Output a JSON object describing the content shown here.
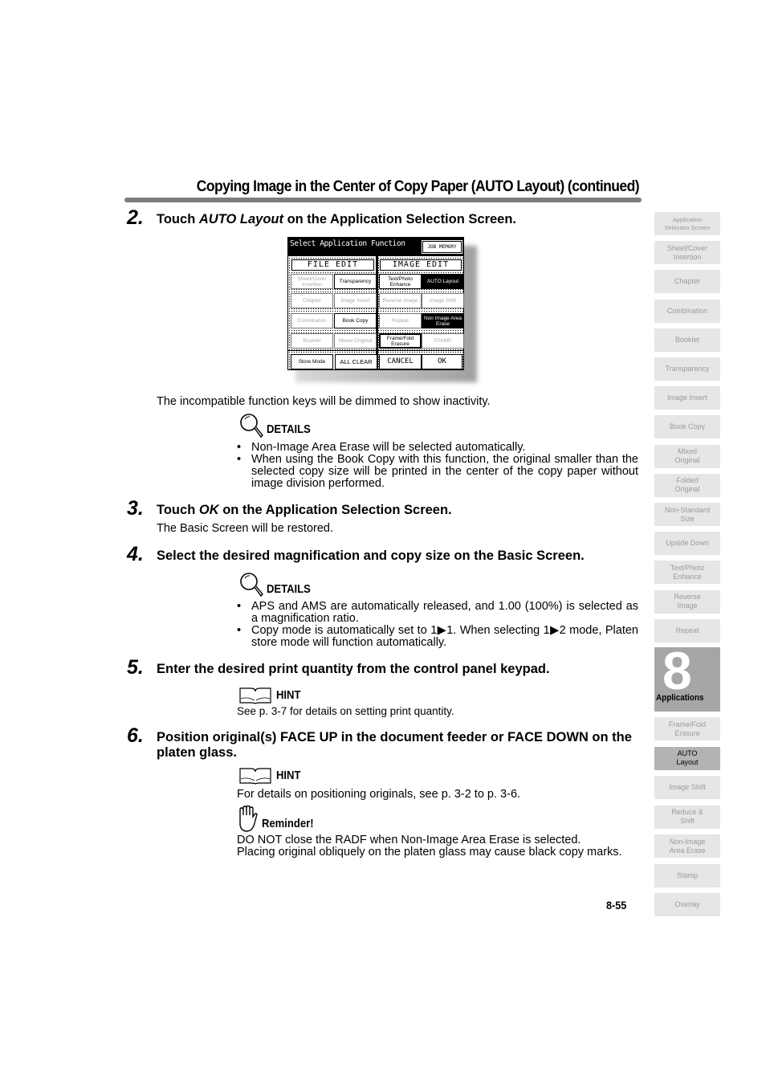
{
  "header": {
    "title": "Copying Image in the Center of Copy Paper (AUTO Layout) (continued)"
  },
  "steps": [
    {
      "number": "2.",
      "heading_pre": "Touch ",
      "heading_em": "AUTO Layout",
      "heading_post": " on the Application Selection Screen.",
      "after_text": "The incompatible function keys will be dimmed to show inactivity.",
      "note": {
        "type": "DETAILS",
        "icon": "magnifier-icon",
        "bullets": [
          "Non-Image Area Erase will be selected automatically.",
          "When using the Book Copy with this function, the original smaller than the selected copy size will be printed in the center of the copy paper without image division performed."
        ]
      }
    },
    {
      "number": "3.",
      "heading_pre": "Touch ",
      "heading_em": "OK",
      "heading_post": " on the Application Selection Screen.",
      "after_text": "The Basic Screen will be restored."
    },
    {
      "number": "4.",
      "heading": "Select the desired magnification and copy size on the Basic Screen.",
      "note": {
        "type": "DETAILS",
        "icon": "magnifier-icon",
        "bullets": [
          "APS and AMS are automatically released, and 1.00 (100%) is selected as a magnification ratio.",
          "Copy mode is automatically set to 1▶1. When selecting 1▶2 mode, Platen store mode will function automatically."
        ]
      }
    },
    {
      "number": "5.",
      "heading": "Enter the desired print quantity from the control panel keypad.",
      "note": {
        "type": "HINT",
        "icon": "open-book-icon",
        "text": "See p. 3-7 for details on setting print quantity."
      }
    },
    {
      "number": "6.",
      "heading": "Position original(s) FACE UP in the document feeder or FACE DOWN on the platen glass.",
      "note": {
        "type": "HINT",
        "icon": "open-book-icon",
        "text": "For details on positioning originals, see p. 3-2 to p. 3-6."
      },
      "reminder": {
        "type": "Reminder!",
        "icon": "hand-icon",
        "lines": [
          "DO NOT close the RADF when Non-Image Area Erase is selected.",
          "Placing original obliquely on the platen glass may cause black copy marks."
        ]
      }
    }
  ],
  "screen": {
    "title": "Select Application Function",
    "job_memory": "JOB MEMORY",
    "file_edit": "FILE EDIT",
    "image_edit": "IMAGE EDIT",
    "keys": [
      {
        "label": "Sheet/Cover Insertion",
        "state": "dimmed"
      },
      {
        "label": "Transparency",
        "state": "active"
      },
      {
        "label": "Text/Photo Enhance",
        "state": "active"
      },
      {
        "label": "AUTO Layout",
        "state": "selected"
      },
      {
        "label": "Chapter",
        "state": "dimmed"
      },
      {
        "label": "Image Insert",
        "state": "dimmed"
      },
      {
        "label": "Reverse Image",
        "state": "dimmed"
      },
      {
        "label": "Image Shift",
        "state": "dimmed"
      },
      {
        "label": "Combination",
        "state": "dimmed"
      },
      {
        "label": "Book Copy",
        "state": "active"
      },
      {
        "label": "Repeat",
        "state": "dimmed"
      },
      {
        "label": "Non Image Area Erase",
        "state": "selected"
      },
      {
        "label": "Booklet",
        "state": "dimmed"
      },
      {
        "label": "Mixed Original",
        "state": "dimmed"
      },
      {
        "label": "Frame/Fold Erasure",
        "state": "active"
      },
      {
        "label": "STAMP",
        "state": "dimmed"
      }
    ],
    "bottom": {
      "store_mode": "Store Mode",
      "all_clear": "ALL CLEAR",
      "cancel": "CANCEL",
      "ok": "OK"
    }
  },
  "sidebar": {
    "chapter_number": "8",
    "chapter_label": "Applications",
    "tabs_before": [
      "Application\nSelection Screen",
      "Sheet/Cover\nInsertion",
      "Chapter",
      "Combination",
      "Booklet",
      "Transparency",
      "Image Insert",
      "Book Copy",
      "Mixed\nOriginal",
      "Folded\nOriginal",
      "Non-Standard\nSize",
      "Upside Down",
      "Text/Photo\nEnhance",
      "Reverse\nImage",
      "Repeat"
    ],
    "tabs_after": [
      "Frame/Fold\nErasure",
      "AUTO\nLayout",
      "Image Shift",
      "Reduce &\nShift",
      "Non-Image\nArea Erase",
      "Stamp",
      "Overlay"
    ],
    "active_tab": "AUTO\nLayout"
  },
  "footer": {
    "page_number": "8-55"
  },
  "colors": {
    "title_rule": "#7d7d7d",
    "tab_bg": "#e6e6e6",
    "tab_text": "#9a9a9a",
    "tab_active_bg": "#b3b3b3",
    "chapter_bg": "#a6a6a6"
  }
}
